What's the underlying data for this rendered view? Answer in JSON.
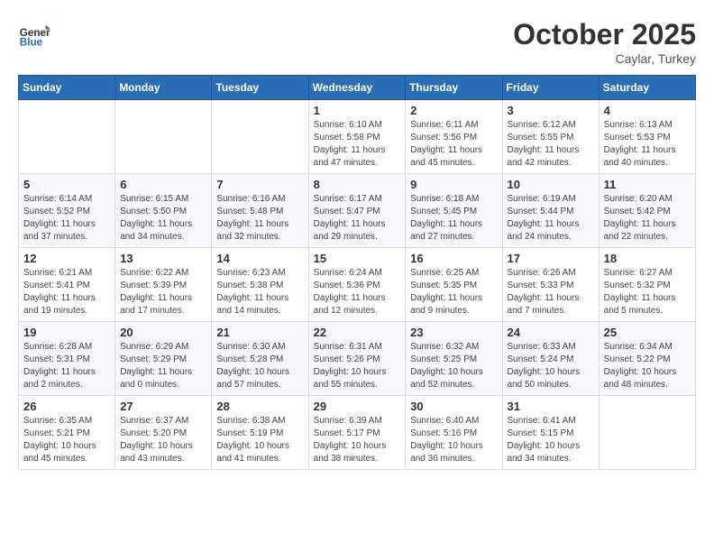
{
  "header": {
    "logo_line1": "General",
    "logo_line2": "Blue",
    "month": "October 2025",
    "location": "Caylar, Turkey"
  },
  "days_of_week": [
    "Sunday",
    "Monday",
    "Tuesday",
    "Wednesday",
    "Thursday",
    "Friday",
    "Saturday"
  ],
  "weeks": [
    [
      {
        "day": "",
        "info": ""
      },
      {
        "day": "",
        "info": ""
      },
      {
        "day": "",
        "info": ""
      },
      {
        "day": "1",
        "info": "Sunrise: 6:10 AM\nSunset: 5:58 PM\nDaylight: 11 hours and 47 minutes."
      },
      {
        "day": "2",
        "info": "Sunrise: 6:11 AM\nSunset: 5:56 PM\nDaylight: 11 hours and 45 minutes."
      },
      {
        "day": "3",
        "info": "Sunrise: 6:12 AM\nSunset: 5:55 PM\nDaylight: 11 hours and 42 minutes."
      },
      {
        "day": "4",
        "info": "Sunrise: 6:13 AM\nSunset: 5:53 PM\nDaylight: 11 hours and 40 minutes."
      }
    ],
    [
      {
        "day": "5",
        "info": "Sunrise: 6:14 AM\nSunset: 5:52 PM\nDaylight: 11 hours and 37 minutes."
      },
      {
        "day": "6",
        "info": "Sunrise: 6:15 AM\nSunset: 5:50 PM\nDaylight: 11 hours and 34 minutes."
      },
      {
        "day": "7",
        "info": "Sunrise: 6:16 AM\nSunset: 5:48 PM\nDaylight: 11 hours and 32 minutes."
      },
      {
        "day": "8",
        "info": "Sunrise: 6:17 AM\nSunset: 5:47 PM\nDaylight: 11 hours and 29 minutes."
      },
      {
        "day": "9",
        "info": "Sunrise: 6:18 AM\nSunset: 5:45 PM\nDaylight: 11 hours and 27 minutes."
      },
      {
        "day": "10",
        "info": "Sunrise: 6:19 AM\nSunset: 5:44 PM\nDaylight: 11 hours and 24 minutes."
      },
      {
        "day": "11",
        "info": "Sunrise: 6:20 AM\nSunset: 5:42 PM\nDaylight: 11 hours and 22 minutes."
      }
    ],
    [
      {
        "day": "12",
        "info": "Sunrise: 6:21 AM\nSunset: 5:41 PM\nDaylight: 11 hours and 19 minutes."
      },
      {
        "day": "13",
        "info": "Sunrise: 6:22 AM\nSunset: 5:39 PM\nDaylight: 11 hours and 17 minutes."
      },
      {
        "day": "14",
        "info": "Sunrise: 6:23 AM\nSunset: 5:38 PM\nDaylight: 11 hours and 14 minutes."
      },
      {
        "day": "15",
        "info": "Sunrise: 6:24 AM\nSunset: 5:36 PM\nDaylight: 11 hours and 12 minutes."
      },
      {
        "day": "16",
        "info": "Sunrise: 6:25 AM\nSunset: 5:35 PM\nDaylight: 11 hours and 9 minutes."
      },
      {
        "day": "17",
        "info": "Sunrise: 6:26 AM\nSunset: 5:33 PM\nDaylight: 11 hours and 7 minutes."
      },
      {
        "day": "18",
        "info": "Sunrise: 6:27 AM\nSunset: 5:32 PM\nDaylight: 11 hours and 5 minutes."
      }
    ],
    [
      {
        "day": "19",
        "info": "Sunrise: 6:28 AM\nSunset: 5:31 PM\nDaylight: 11 hours and 2 minutes."
      },
      {
        "day": "20",
        "info": "Sunrise: 6:29 AM\nSunset: 5:29 PM\nDaylight: 11 hours and 0 minutes."
      },
      {
        "day": "21",
        "info": "Sunrise: 6:30 AM\nSunset: 5:28 PM\nDaylight: 10 hours and 57 minutes."
      },
      {
        "day": "22",
        "info": "Sunrise: 6:31 AM\nSunset: 5:26 PM\nDaylight: 10 hours and 55 minutes."
      },
      {
        "day": "23",
        "info": "Sunrise: 6:32 AM\nSunset: 5:25 PM\nDaylight: 10 hours and 52 minutes."
      },
      {
        "day": "24",
        "info": "Sunrise: 6:33 AM\nSunset: 5:24 PM\nDaylight: 10 hours and 50 minutes."
      },
      {
        "day": "25",
        "info": "Sunrise: 6:34 AM\nSunset: 5:22 PM\nDaylight: 10 hours and 48 minutes."
      }
    ],
    [
      {
        "day": "26",
        "info": "Sunrise: 6:35 AM\nSunset: 5:21 PM\nDaylight: 10 hours and 45 minutes."
      },
      {
        "day": "27",
        "info": "Sunrise: 6:37 AM\nSunset: 5:20 PM\nDaylight: 10 hours and 43 minutes."
      },
      {
        "day": "28",
        "info": "Sunrise: 6:38 AM\nSunset: 5:19 PM\nDaylight: 10 hours and 41 minutes."
      },
      {
        "day": "29",
        "info": "Sunrise: 6:39 AM\nSunset: 5:17 PM\nDaylight: 10 hours and 38 minutes."
      },
      {
        "day": "30",
        "info": "Sunrise: 6:40 AM\nSunset: 5:16 PM\nDaylight: 10 hours and 36 minutes."
      },
      {
        "day": "31",
        "info": "Sunrise: 6:41 AM\nSunset: 5:15 PM\nDaylight: 10 hours and 34 minutes."
      },
      {
        "day": "",
        "info": ""
      }
    ]
  ]
}
